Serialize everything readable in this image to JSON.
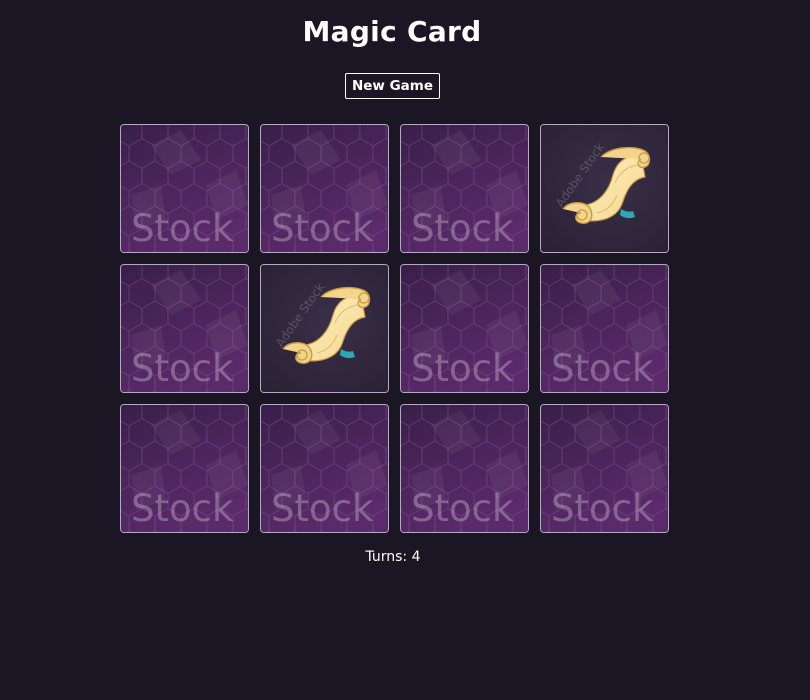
{
  "game": {
    "title": "Magic Card",
    "new_game_label": "New Game",
    "turns_label": "Turns:",
    "turns_value": "4"
  },
  "card_back": {
    "watermark_text": "Stock",
    "colors": {
      "background_top": "#3a1f4a",
      "background_bottom": "#5a2a6a",
      "hex_lines": "#8a5a9a",
      "border": "#b6aac3"
    }
  },
  "card_front": {
    "icon": "scroll-icon",
    "watermark_text": "Adobe Stock",
    "colors": {
      "background": "#2a2235",
      "parchment": "#f2d58a",
      "parchment_shadow": "#c99a45",
      "ribbon": "#2ea7b5"
    }
  },
  "cards": [
    {
      "state": "face-down"
    },
    {
      "state": "face-down"
    },
    {
      "state": "face-down"
    },
    {
      "state": "face-up",
      "icon": "scroll-icon"
    },
    {
      "state": "face-down"
    },
    {
      "state": "face-up",
      "icon": "scroll-icon"
    },
    {
      "state": "face-down"
    },
    {
      "state": "face-down"
    },
    {
      "state": "face-down"
    },
    {
      "state": "face-down"
    },
    {
      "state": "face-down"
    },
    {
      "state": "face-down"
    }
  ]
}
